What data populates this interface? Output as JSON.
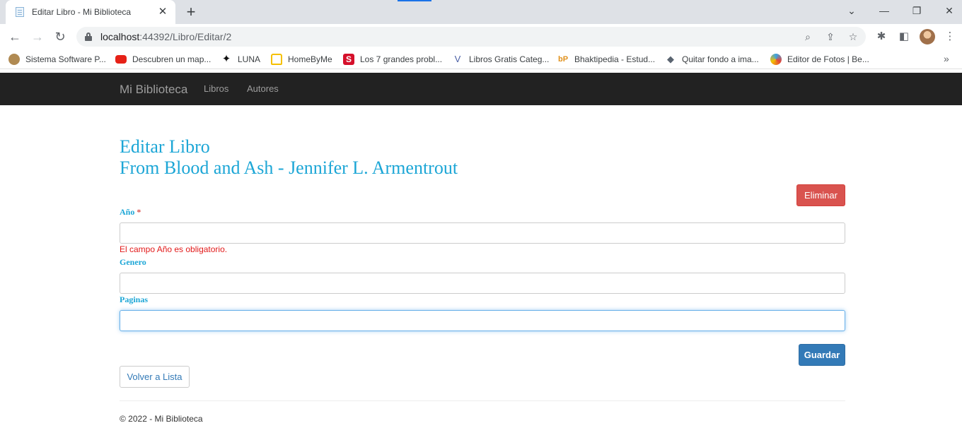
{
  "browser": {
    "tab_title": "Editar Libro - Mi Biblioteca",
    "tab_close": "✕",
    "new_tab": "+",
    "url_host": "localhost",
    "url_path": ":44392/Libro/Editar/2",
    "bookmarks": [
      {
        "label": "Sistema Software P...",
        "icon": "snake-bowl-icon",
        "color": "#b08a52"
      },
      {
        "label": "Descubren un map...",
        "icon": "youtube-icon",
        "color": "#e62117"
      },
      {
        "label": "LUNA",
        "icon": "sparkle-icon",
        "color": "#111111"
      },
      {
        "label": "HomeByMe",
        "icon": "home-icon",
        "color": "#f5c000"
      },
      {
        "label": "Los 7 grandes probl...",
        "icon": "s-icon",
        "color": "#d5102b"
      },
      {
        "label": "Libros Gratis Categ...",
        "icon": "v-icon",
        "color": "#4a5fa5"
      },
      {
        "label": "Bhaktipedia - Estud...",
        "icon": "bp-icon",
        "color": "#e0901a"
      },
      {
        "label": "Quitar fondo a ima...",
        "icon": "layers-icon",
        "color": "#5a6470"
      },
      {
        "label": "Editor de Fotos | Be...",
        "icon": "befunky-icon",
        "color": "#3aa3e3"
      }
    ],
    "more": "»"
  },
  "nav": {
    "brand": "Mi Biblioteca",
    "links": [
      "Libros",
      "Autores"
    ]
  },
  "page": {
    "title_line1": "Editar Libro",
    "title_line2": "From Blood and Ash - Jennifer L. Armentrout",
    "delete_button": "Eliminar",
    "fields": {
      "anio_label": "Año",
      "anio_required": "*",
      "anio_value": "",
      "anio_error": "El campo Año es obligatorio.",
      "genero_label": "Genero",
      "genero_value": "",
      "paginas_label": "Paginas",
      "paginas_value": ""
    },
    "save_button": "Guardar",
    "back_button": "Volver a Lista"
  },
  "footer": {
    "text": "© 2022 - Mi Biblioteca"
  },
  "colors": {
    "heading": "#1ca6d6",
    "danger": "#d9534f",
    "primary": "#337ab7",
    "navbar": "#222222",
    "error": "#e21a1a"
  }
}
